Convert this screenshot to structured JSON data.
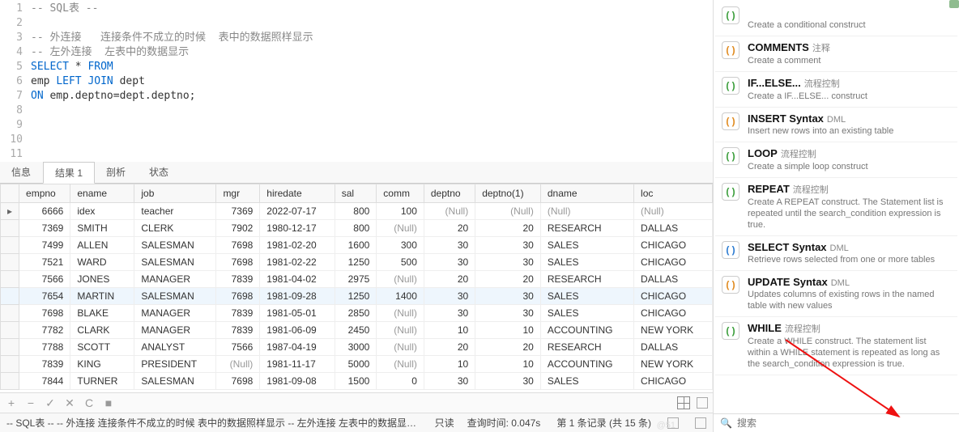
{
  "editor": {
    "lines": [
      {
        "n": "1",
        "html": "<span class='cm'>-- SQL表 --</span>"
      },
      {
        "n": "2",
        "html": ""
      },
      {
        "n": "3",
        "html": "<span class='cm'>-- 外连接   连接条件不成立的时候  表中的数据照样显示</span>"
      },
      {
        "n": "4",
        "html": "<span class='cm'>-- 左外连接  左表中的数据显示</span>"
      },
      {
        "n": "5",
        "html": "<span class='kw'>SELECT</span> * <span class='kw'>FROM</span>"
      },
      {
        "n": "6",
        "html": "emp <span class='kw'>LEFT JOIN</span> dept"
      },
      {
        "n": "7",
        "html": "<span class='kw'>ON</span> emp.deptno=dept.deptno;"
      },
      {
        "n": "8",
        "html": ""
      },
      {
        "n": "9",
        "html": ""
      },
      {
        "n": "10",
        "html": ""
      },
      {
        "n": "11",
        "html": ""
      }
    ]
  },
  "tabs": [
    "信息",
    "结果 1",
    "剖析",
    "状态"
  ],
  "active_tab": 1,
  "columns": [
    "empno",
    "ename",
    "job",
    "mgr",
    "hiredate",
    "sal",
    "comm",
    "deptno",
    "deptno(1)",
    "dname",
    "loc"
  ],
  "rows": [
    {
      "ptr": "▸",
      "empno": "6666",
      "ename": "idex",
      "job": "teacher",
      "mgr": "7369",
      "hiredate": "2022-07-17",
      "sal": "800",
      "comm": "100",
      "deptno": "(Null)",
      "deptno1": "(Null)",
      "dname": "(Null)",
      "loc": "(Null)"
    },
    {
      "empno": "7369",
      "ename": "SMITH",
      "job": "CLERK",
      "mgr": "7902",
      "hiredate": "1980-12-17",
      "sal": "800",
      "comm": "(Null)",
      "deptno": "20",
      "deptno1": "20",
      "dname": "RESEARCH",
      "loc": "DALLAS"
    },
    {
      "empno": "7499",
      "ename": "ALLEN",
      "job": "SALESMAN",
      "mgr": "7698",
      "hiredate": "1981-02-20",
      "sal": "1600",
      "comm": "300",
      "deptno": "30",
      "deptno1": "30",
      "dname": "SALES",
      "loc": "CHICAGO"
    },
    {
      "empno": "7521",
      "ename": "WARD",
      "job": "SALESMAN",
      "mgr": "7698",
      "hiredate": "1981-02-22",
      "sal": "1250",
      "comm": "500",
      "deptno": "30",
      "deptno1": "30",
      "dname": "SALES",
      "loc": "CHICAGO"
    },
    {
      "empno": "7566",
      "ename": "JONES",
      "job": "MANAGER",
      "mgr": "7839",
      "hiredate": "1981-04-02",
      "sal": "2975",
      "comm": "(Null)",
      "deptno": "20",
      "deptno1": "20",
      "dname": "RESEARCH",
      "loc": "DALLAS"
    },
    {
      "hl": true,
      "empno": "7654",
      "ename": "MARTIN",
      "job": "SALESMAN",
      "mgr": "7698",
      "hiredate": "1981-09-28",
      "sal": "1250",
      "comm": "1400",
      "deptno": "30",
      "deptno1": "30",
      "dname": "SALES",
      "loc": "CHICAGO"
    },
    {
      "empno": "7698",
      "ename": "BLAKE",
      "job": "MANAGER",
      "mgr": "7839",
      "hiredate": "1981-05-01",
      "sal": "2850",
      "comm": "(Null)",
      "deptno": "30",
      "deptno1": "30",
      "dname": "SALES",
      "loc": "CHICAGO"
    },
    {
      "empno": "7782",
      "ename": "CLARK",
      "job": "MANAGER",
      "mgr": "7839",
      "hiredate": "1981-06-09",
      "sal": "2450",
      "comm": "(Null)",
      "deptno": "10",
      "deptno1": "10",
      "dname": "ACCOUNTING",
      "loc": "NEW YORK"
    },
    {
      "empno": "7788",
      "ename": "SCOTT",
      "job": "ANALYST",
      "mgr": "7566",
      "hiredate": "1987-04-19",
      "sal": "3000",
      "comm": "(Null)",
      "deptno": "20",
      "deptno1": "20",
      "dname": "RESEARCH",
      "loc": "DALLAS"
    },
    {
      "empno": "7839",
      "ename": "KING",
      "job": "PRESIDENT",
      "mgr": "(Null)",
      "hiredate": "1981-11-17",
      "sal": "5000",
      "comm": "(Null)",
      "deptno": "10",
      "deptno1": "10",
      "dname": "ACCOUNTING",
      "loc": "NEW YORK"
    },
    {
      "empno": "7844",
      "ename": "TURNER",
      "job": "SALESMAN",
      "mgr": "7698",
      "hiredate": "1981-09-08",
      "sal": "1500",
      "comm": "0",
      "deptno": "30",
      "deptno1": "30",
      "dname": "SALES",
      "loc": "CHICAGO"
    }
  ],
  "toolbar": {
    "plus": "+",
    "minus": "−",
    "check": "✓",
    "x": "✕",
    "refresh": "C",
    "stop": "■"
  },
  "status": {
    "query_text": "-- SQL表 -- -- 外连接   连接条件不成立的时候  表中的数据照样显示 -- 左外连接 左表中的数据显示 SELECT * FROM  emp",
    "readonly": "只读",
    "time_label": "查询时间:",
    "time_value": "0.047s",
    "record": "第 1 条记录 (共 15 条)"
  },
  "snippets": [
    {
      "color": "green",
      "title": "",
      "tag": "",
      "desc": "Create a conditional construct"
    },
    {
      "color": "orange",
      "title": "COMMENTS",
      "tag": "注释",
      "desc": "Create a comment"
    },
    {
      "color": "green",
      "title": "IF...ELSE...",
      "tag": "流程控制",
      "desc": "Create a IF...ELSE... construct"
    },
    {
      "color": "orange",
      "title": "INSERT Syntax",
      "tag": "DML",
      "desc": "Insert new rows into an existing table"
    },
    {
      "color": "green",
      "title": "LOOP",
      "tag": "流程控制",
      "desc": "Create a simple loop construct"
    },
    {
      "color": "green",
      "title": "REPEAT",
      "tag": "流程控制",
      "desc": "Create A REPEAT construct. The Statement list is repeated until the search_condition expression is true."
    },
    {
      "color": "blue",
      "title": "SELECT Syntax",
      "tag": "DML",
      "desc": "Retrieve rows selected from one or more tables"
    },
    {
      "color": "orange",
      "title": "UPDATE Syntax",
      "tag": "DML",
      "desc": "Updates columns of existing rows in the named table with new values"
    },
    {
      "color": "green",
      "title": "WHILE",
      "tag": "流程控制",
      "desc": "Create a WHILE construct. The statement list within a WHILE statement is repeated as long as the search_condition expression is true."
    }
  ],
  "search": {
    "placeholder": "搜索"
  },
  "watermark": "@51"
}
